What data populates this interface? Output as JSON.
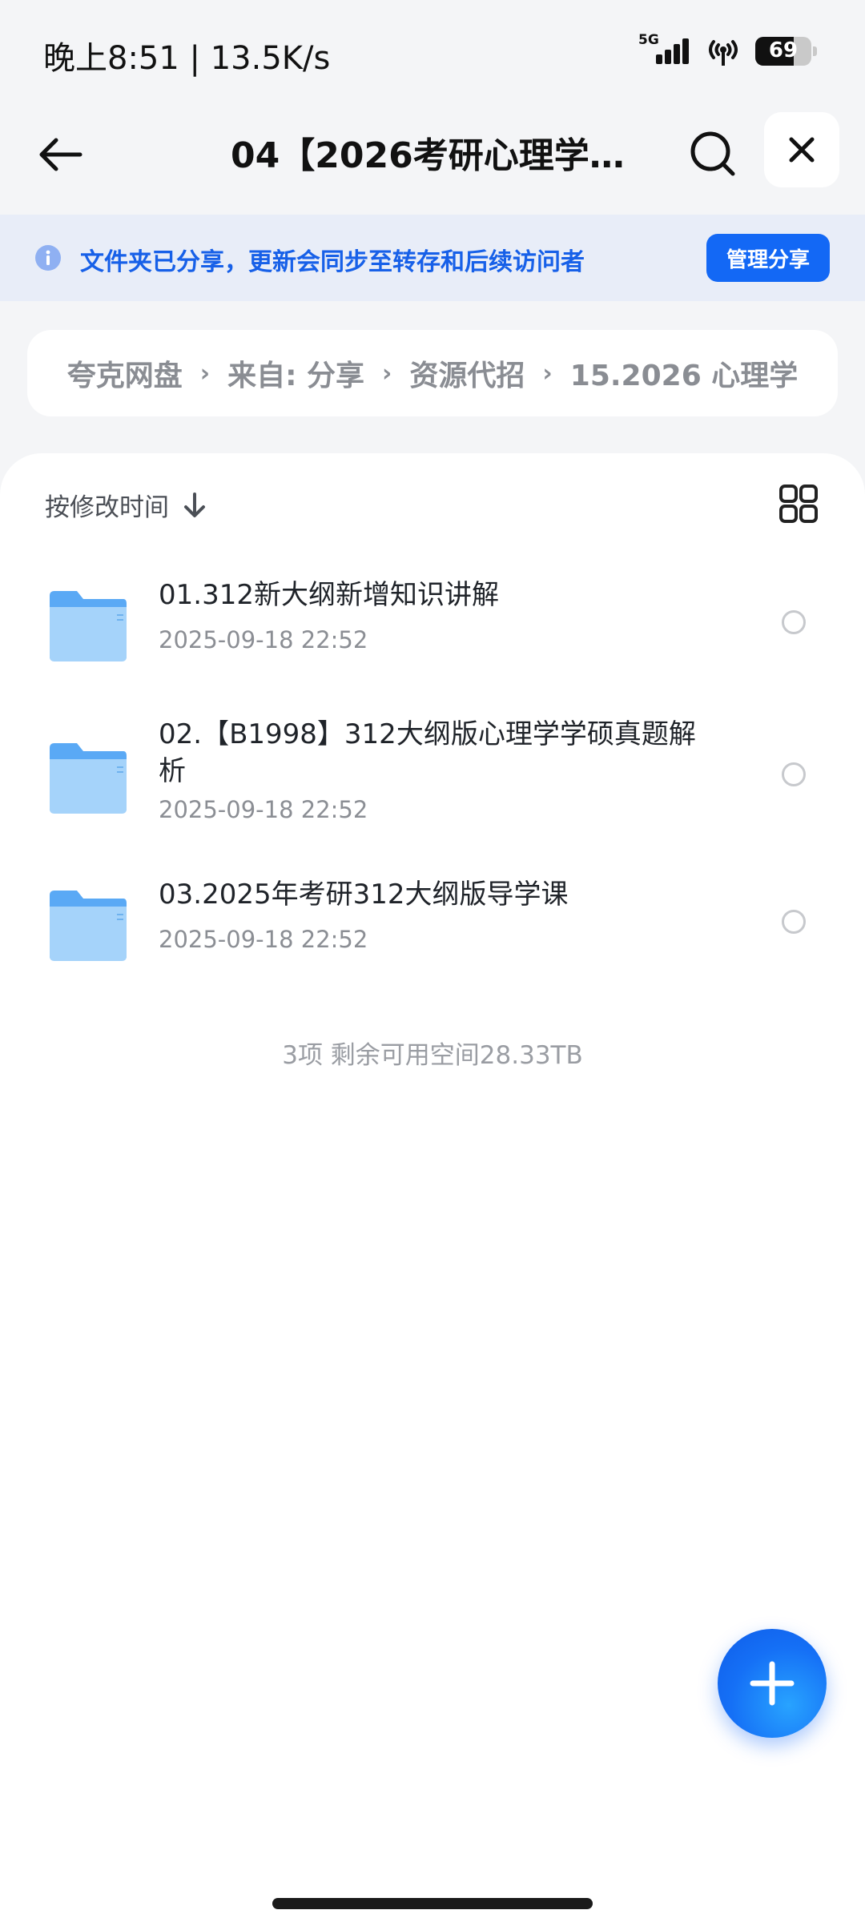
{
  "status_bar": {
    "time": "晚上8:51 | 13.5K/s",
    "network": "5G",
    "battery": "69",
    "battery_level": 0.69
  },
  "header": {
    "title": "04【2026考研心理学】…"
  },
  "share_banner": {
    "text": "文件夹已分享，更新会同步至转存和后续访问者",
    "manage_label": "管理分享"
  },
  "breadcrumb": [
    "夸克网盘",
    "来自: 分享",
    "资源代招",
    "15.2026 心理学"
  ],
  "sort": {
    "label": "按修改时间"
  },
  "files": [
    {
      "name": "01.312新大纲新增知识讲解",
      "date": "2025-09-18 22:52"
    },
    {
      "name": "02.【B1998】312大纲版心理学学硕真题解析",
      "date": "2025-09-18 22:52"
    },
    {
      "name": "03.2025年考研312大纲版导学课",
      "date": "2025-09-18 22:52"
    }
  ],
  "footer": {
    "summary": "3项 剩余可用空间28.33TB"
  },
  "colors": {
    "accent": "#1368f5",
    "banner_bg": "#e8edf8",
    "folder": "#5aa9f5"
  },
  "icons": {
    "back": "arrow-left-icon",
    "search": "search-icon",
    "close": "close-icon",
    "info": "info-icon",
    "sort": "arrow-down-icon",
    "grid": "grid-view-icon",
    "folder": "folder-icon",
    "add": "plus-icon"
  }
}
